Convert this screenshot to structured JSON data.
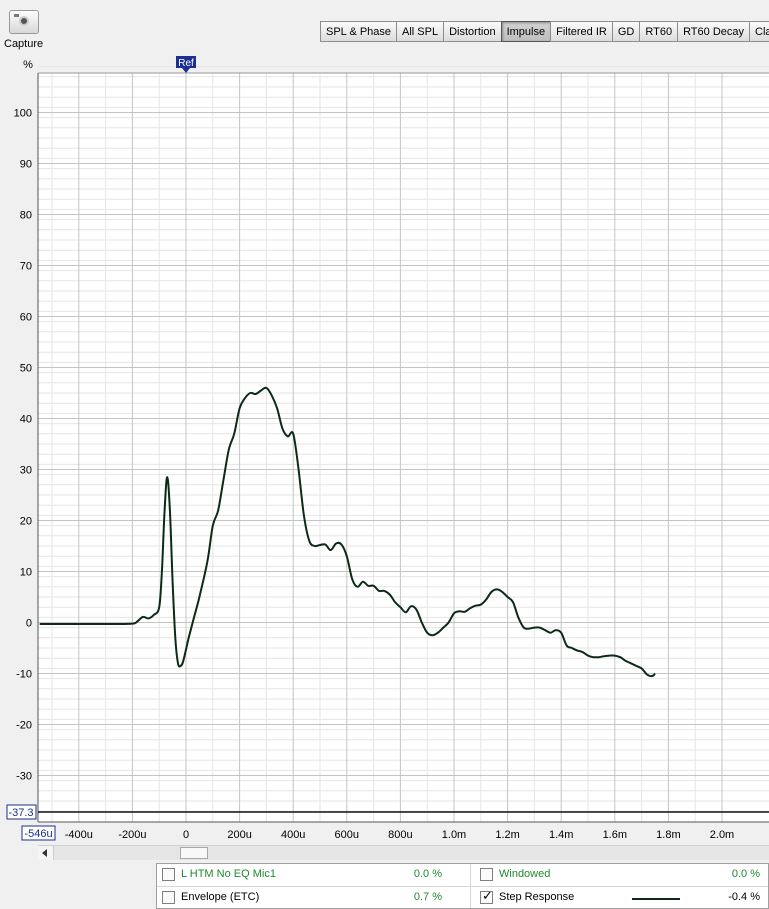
{
  "toolbar": {
    "capture_label": "Capture",
    "tabs": [
      {
        "label": "SPL & Phase",
        "active": false
      },
      {
        "label": "All SPL",
        "active": false
      },
      {
        "label": "Distortion",
        "active": false
      },
      {
        "label": "Impulse",
        "active": true
      },
      {
        "label": "Filtered IR",
        "active": false
      },
      {
        "label": "GD",
        "active": false
      },
      {
        "label": "RT60",
        "active": false
      },
      {
        "label": "RT60 Decay",
        "active": false
      },
      {
        "label": "Clarity",
        "active": false
      }
    ]
  },
  "chart_data": {
    "type": "line",
    "ylabel": "%",
    "ylim": [
      -37.3,
      110
    ],
    "xlim": [
      -0.000546,
      0.002
    ],
    "yticks": [
      100,
      90,
      80,
      70,
      60,
      50,
      40,
      30,
      20,
      10,
      0,
      -10,
      -20,
      -30
    ],
    "y_min_label": "-37.3",
    "xticks": [
      {
        "v": -0.0004,
        "label": "-400u"
      },
      {
        "v": -0.0002,
        "label": "-200u"
      },
      {
        "v": 0,
        "label": "0"
      },
      {
        "v": 0.0002,
        "label": "200u"
      },
      {
        "v": 0.0004,
        "label": "400u"
      },
      {
        "v": 0.0006,
        "label": "600u"
      },
      {
        "v": 0.0008,
        "label": "800u"
      },
      {
        "v": 0.001,
        "label": "1.0m"
      },
      {
        "v": 0.0012,
        "label": "1.2m"
      },
      {
        "v": 0.0014,
        "label": "1.4m"
      },
      {
        "v": 0.0016,
        "label": "1.6m"
      },
      {
        "v": 0.0018,
        "label": "1.8m"
      },
      {
        "v": 0.002,
        "label": "2.0m"
      }
    ],
    "x_min_label": "-546u",
    "ref_marker": {
      "label": "Ref",
      "x": 0
    },
    "grid": true,
    "series": [
      {
        "name": "Step Response",
        "color": "#0b2b18",
        "points": [
          [
            -0.000546,
            -0.3
          ],
          [
            -0.0004,
            -0.3
          ],
          [
            -0.00025,
            -0.3
          ],
          [
            -0.000195,
            -0.2
          ],
          [
            -0.00018,
            0.3
          ],
          [
            -0.00016,
            1.1
          ],
          [
            -0.00014,
            0.8
          ],
          [
            -0.00012,
            1.5
          ],
          [
            -0.0001,
            3
          ],
          [
            -9e-05,
            10
          ],
          [
            -8e-05,
            22
          ],
          [
            -7e-05,
            28.5
          ],
          [
            -6e-05,
            22
          ],
          [
            -5e-05,
            8
          ],
          [
            -4e-05,
            -3
          ],
          [
            -3e-05,
            -8
          ],
          [
            -2e-05,
            -8.5
          ],
          [
            -1e-05,
            -7.5
          ],
          [
            1e-05,
            -3
          ],
          [
            3e-05,
            1
          ],
          [
            5e-05,
            5
          ],
          [
            8e-05,
            12
          ],
          [
            0.0001,
            19
          ],
          [
            0.00012,
            22
          ],
          [
            0.00014,
            28
          ],
          [
            0.00016,
            34
          ],
          [
            0.00018,
            37
          ],
          [
            0.0002,
            42
          ],
          [
            0.00022,
            44
          ],
          [
            0.00024,
            45
          ],
          [
            0.00026,
            44.8
          ],
          [
            0.00028,
            45.5
          ],
          [
            0.0003,
            46
          ],
          [
            0.00032,
            44.5
          ],
          [
            0.00034,
            42
          ],
          [
            0.00036,
            38
          ],
          [
            0.00038,
            36.5
          ],
          [
            0.0004,
            37
          ],
          [
            0.00042,
            30
          ],
          [
            0.00044,
            21
          ],
          [
            0.00046,
            16
          ],
          [
            0.00048,
            15
          ],
          [
            0.0005,
            15.2
          ],
          [
            0.00052,
            15.3
          ],
          [
            0.00054,
            14.2
          ],
          [
            0.00056,
            15.5
          ],
          [
            0.00058,
            15.3
          ],
          [
            0.0006,
            13
          ],
          [
            0.00062,
            8.5
          ],
          [
            0.00064,
            7
          ],
          [
            0.00066,
            8
          ],
          [
            0.00068,
            7.2
          ],
          [
            0.0007,
            7.2
          ],
          [
            0.00072,
            6.2
          ],
          [
            0.00074,
            6.2
          ],
          [
            0.00076,
            5.5
          ],
          [
            0.00078,
            4
          ],
          [
            0.0008,
            3
          ],
          [
            0.00082,
            2
          ],
          [
            0.00084,
            3.2
          ],
          [
            0.00086,
            2.5
          ],
          [
            0.00088,
            0
          ],
          [
            0.0009,
            -2
          ],
          [
            0.00092,
            -2.5
          ],
          [
            0.00094,
            -2
          ],
          [
            0.00096,
            -1
          ],
          [
            0.00098,
            0
          ],
          [
            0.001,
            1.8
          ],
          [
            0.00102,
            2.2
          ],
          [
            0.00104,
            2.1
          ],
          [
            0.00106,
            2.8
          ],
          [
            0.00108,
            3.3
          ],
          [
            0.0011,
            3.5
          ],
          [
            0.00112,
            4.5
          ],
          [
            0.00114,
            6
          ],
          [
            0.00116,
            6.5
          ],
          [
            0.00118,
            6
          ],
          [
            0.0012,
            5
          ],
          [
            0.00122,
            4
          ],
          [
            0.00124,
            1
          ],
          [
            0.00126,
            -1
          ],
          [
            0.00128,
            -1.2
          ],
          [
            0.0013,
            -1
          ],
          [
            0.00132,
            -1
          ],
          [
            0.00134,
            -1.5
          ],
          [
            0.00136,
            -2
          ],
          [
            0.00138,
            -1.5
          ],
          [
            0.0014,
            -2
          ],
          [
            0.00142,
            -4.5
          ],
          [
            0.00144,
            -5
          ],
          [
            0.00146,
            -5.5
          ],
          [
            0.00148,
            -5.8
          ],
          [
            0.0015,
            -6.5
          ],
          [
            0.00152,
            -6.8
          ],
          [
            0.00154,
            -6.8
          ],
          [
            0.00156,
            -6.6
          ],
          [
            0.00158,
            -6.5
          ],
          [
            0.0016,
            -6.5
          ],
          [
            0.00162,
            -6.8
          ],
          [
            0.00164,
            -7.5
          ],
          [
            0.00166,
            -8
          ],
          [
            0.00168,
            -8.5
          ],
          [
            0.0017,
            -9
          ],
          [
            0.00172,
            -10.2
          ],
          [
            0.00174,
            -10.5
          ],
          [
            0.00175,
            -10
          ]
        ]
      }
    ]
  },
  "legend": {
    "row1": {
      "name": "L HTM No EQ Mic1",
      "checked": false,
      "value": "0.0 %",
      "option": "Windowed",
      "option_checked": false,
      "option_value": "0.0 %"
    },
    "row2": {
      "name": "Envelope (ETC)",
      "checked": false,
      "value": "0.7 %",
      "option": "Step Response",
      "option_checked": true,
      "option_value": "-0.4 %"
    }
  },
  "colors": {
    "trace": "#0b2b18",
    "ref_marker": "#1a2f8f",
    "legend_green": "#1f8a2e"
  }
}
